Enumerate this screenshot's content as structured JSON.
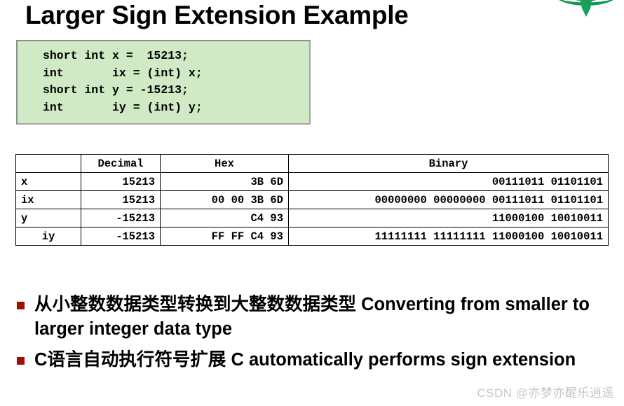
{
  "slide": {
    "title": "Larger Sign Extension Example"
  },
  "logo": {
    "icon": "green-leaf-logo",
    "colors": {
      "dark_green": "#0e9a4e",
      "mid_green": "#23a45c",
      "light_green": "#7cc89a"
    }
  },
  "code_block": {
    "language": "c",
    "background": "#cfeac5",
    "border_color": "#a6a6a6",
    "lines": [
      "short int x =  15213;",
      "int       ix = (int) x;",
      "short int y = -15213;",
      "int       iy = (int) y;"
    ],
    "text": "short int x =  15213;\nint       ix = (int) x;\nshort int y = -15213;\nint       iy = (int) y;"
  },
  "table": {
    "headers": [
      "",
      "Decimal",
      "Hex",
      "Binary"
    ],
    "rows": [
      {
        "label": "x",
        "decimal": "15213",
        "hex": "3B 6D",
        "binary": "00111011 01101101"
      },
      {
        "label": "ix",
        "decimal": "15213",
        "hex": "00 00 3B 6D",
        "binary": "00000000 00000000 00111011 01101101"
      },
      {
        "label": "y",
        "decimal": "-15213",
        "hex": "C4 93",
        "binary": "11000100 10010011"
      },
      {
        "label": "iy",
        "decimal": "-15213",
        "hex": "FF FF C4 93",
        "binary": "11111111 11111111 11000100 10010011"
      }
    ]
  },
  "bullets": {
    "marker_color": "#9c1006",
    "items": [
      "从小整数数据类型转换到大整数数据类型 Converting from smaller to larger integer data type",
      "C语言自动执行符号扩展 C automatically performs sign extension"
    ]
  },
  "watermark": {
    "text": "CSDN @亦梦亦醒乐逍遥"
  }
}
